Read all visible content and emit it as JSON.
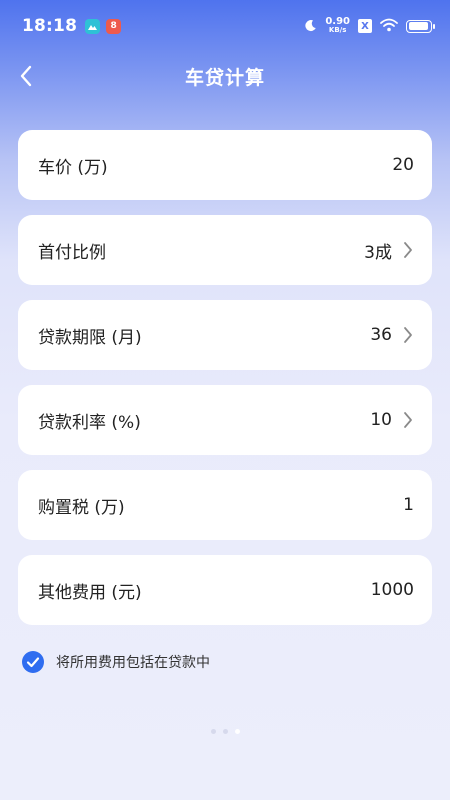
{
  "status_bar": {
    "time": "18:18",
    "app_icon_b": "8",
    "net_speed_value": "0.90",
    "net_speed_unit": "KB/s",
    "sim_label": "X",
    "battery_level": 0.8
  },
  "nav": {
    "back_icon": "chevron-left-icon",
    "title": "车贷计算"
  },
  "fields": [
    {
      "label": "车价 (万)",
      "value": "20",
      "has_chevron": false
    },
    {
      "label": "首付比例",
      "value": "3成",
      "has_chevron": true
    },
    {
      "label": "贷款期限 (月)",
      "value": "36",
      "has_chevron": true
    },
    {
      "label": "贷款利率 (%)",
      "value": "10",
      "has_chevron": true
    },
    {
      "label": "购置税 (万)",
      "value": "1",
      "has_chevron": false
    },
    {
      "label": "其他费用 (元)",
      "value": "1000",
      "has_chevron": false
    }
  ],
  "include_fees": {
    "checked": true,
    "label": "将所用费用包括在贷款中"
  },
  "pager": {
    "count": 3,
    "active_index": 2
  },
  "colors": {
    "accent": "#2f6df0",
    "header_blue": "#4f73ee",
    "background": "#eceefb"
  }
}
